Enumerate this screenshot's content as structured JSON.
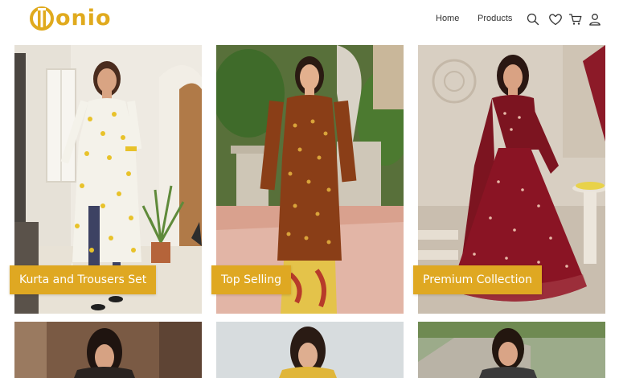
{
  "brand": {
    "name": "onio",
    "accent_color": "#dfa822",
    "logo_icon": "monogram-logo-icon"
  },
  "nav": {
    "home": "Home",
    "products": "Products"
  },
  "header_icons": [
    "search-icon",
    "heart-icon",
    "cart-icon",
    "user-icon"
  ],
  "categories": [
    {
      "label": "Kurta and Trousers Set"
    },
    {
      "label": "Top Selling"
    },
    {
      "label": "Premium Collection"
    }
  ]
}
